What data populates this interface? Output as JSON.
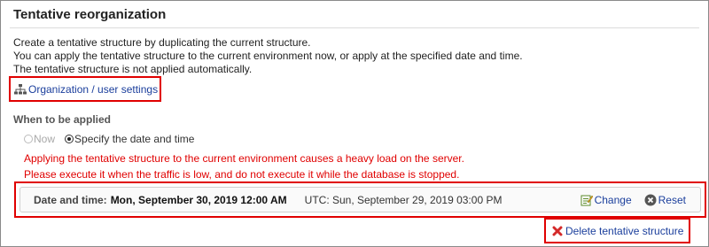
{
  "page": {
    "title": "Tentative reorganization"
  },
  "description": {
    "line1": "Create a tentative structure by duplicating the current structure.",
    "line2": "You can apply the tentative structure to the current environment now, or apply at the specified date and time.",
    "line3": "The tentative structure is not applied automatically."
  },
  "org_link": {
    "label": "Organization / user settings",
    "icon": "org-chart-icon"
  },
  "apply": {
    "section_label": "When to be applied",
    "options": [
      {
        "label": "Now",
        "selected": false,
        "disabled": true
      },
      {
        "label": "Specify the date and time",
        "selected": true,
        "disabled": false
      }
    ],
    "warning_line1": "Applying the tentative structure to the current environment causes a heavy load on the server.",
    "warning_line2": "Please execute it when the traffic is low, and do not execute it while the database is stopped."
  },
  "schedule": {
    "label": "Date and time:",
    "value": "Mon, September 30, 2019 12:00 AM",
    "utc": "UTC: Sun, September 29, 2019 03:00 PM",
    "change_label": "Change",
    "reset_label": "Reset"
  },
  "delete": {
    "label": "Delete tentative structure"
  },
  "colors": {
    "link": "#1a3e9c",
    "warning": "#e00000",
    "highlight_border": "#e00000"
  }
}
